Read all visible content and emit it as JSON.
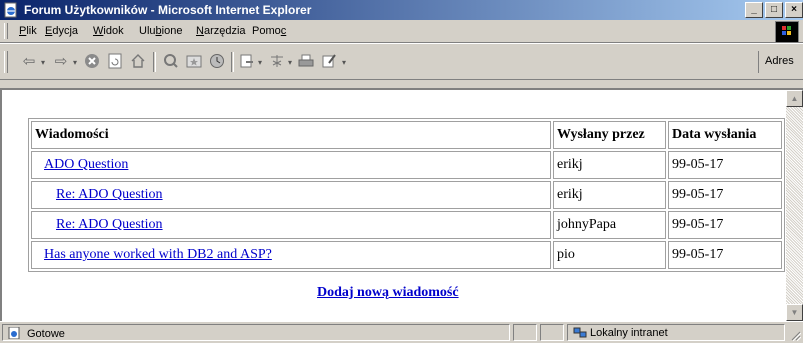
{
  "window": {
    "title": "Forum Użytkowników - Microsoft Internet Explorer",
    "buttons": [
      "_",
      "□",
      "×"
    ]
  },
  "menu": {
    "items": [
      {
        "label": "Plik",
        "underline": "P"
      },
      {
        "label": "Edycja",
        "underline": "E"
      },
      {
        "label": "Widok",
        "underline": "W"
      },
      {
        "label": "Ulubione",
        "underline": "b"
      },
      {
        "label": "Narzędzia",
        "underline": "N"
      },
      {
        "label": "Pomoc",
        "underline": "c"
      }
    ]
  },
  "toolbar": {
    "address_label": "Adres",
    "icons": [
      "back-icon",
      "forward-icon",
      "stop-icon",
      "refresh-icon",
      "home-icon",
      "search-icon",
      "favorites-icon",
      "history-icon",
      "mail-icon",
      "print-icon",
      "edit-icon",
      "discuss-icon"
    ]
  },
  "forum": {
    "headers": {
      "message": "Wiadomości",
      "sender": "Wysłany przez",
      "date": "Data wysłania"
    },
    "rows": [
      {
        "title": "ADO Question",
        "sender": "erikj",
        "date": "99-05-17",
        "indent": 1
      },
      {
        "title": "Re: ADO Question",
        "sender": "erikj",
        "date": "99-05-17",
        "indent": 2
      },
      {
        "title": "Re: ADO Question",
        "sender": "johnyPapa",
        "date": "99-05-17",
        "indent": 2
      },
      {
        "title": "Has anyone worked with DB2 and ASP?",
        "sender": "pio",
        "date": "99-05-17",
        "indent": 1
      }
    ],
    "add_link": "Dodaj nową wiadomość"
  },
  "status": {
    "text": "Gotowe",
    "zone": "Lokalny intranet"
  },
  "colors": {
    "title_start": "#0a246a",
    "title_end": "#a6caf0",
    "link": "#0000cc",
    "chrome": "#d4d0c8"
  }
}
